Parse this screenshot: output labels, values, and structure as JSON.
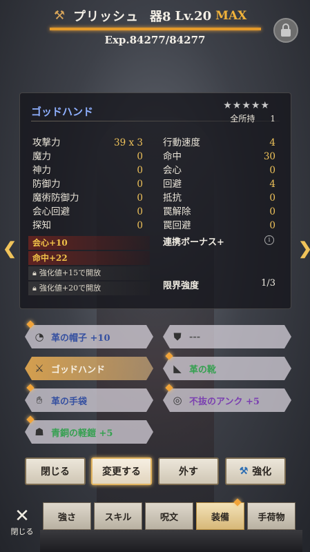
{
  "header": {
    "char_name": "プリッシュ",
    "vessel": "器8",
    "level": "Lv.20",
    "max": "MAX",
    "exp": "Exp.84277/84277"
  },
  "equipment": {
    "name": "ゴッドハンド",
    "stars": "★★★★★",
    "owned_label": "全所持",
    "owned_count": "1",
    "stats_left": [
      {
        "label": "攻撃力",
        "value": "39 x 3"
      },
      {
        "label": "魔力",
        "value": "0"
      },
      {
        "label": "神力",
        "value": "0"
      },
      {
        "label": "防御力",
        "value": "0"
      },
      {
        "label": "魔術防御力",
        "value": "0"
      },
      {
        "label": "会心回避",
        "value": "0"
      },
      {
        "label": "探知",
        "value": "0"
      }
    ],
    "stats_right": [
      {
        "label": "行動速度",
        "value": "4"
      },
      {
        "label": "命中",
        "value": "30"
      },
      {
        "label": "会心",
        "value": "0"
      },
      {
        "label": "回避",
        "value": "4"
      },
      {
        "label": "抵抗",
        "value": "0"
      },
      {
        "label": "罠解除",
        "value": "0"
      },
      {
        "label": "罠回避",
        "value": "0"
      }
    ],
    "bonuses": [
      "会心+10",
      "命中+22"
    ],
    "locked": [
      "強化値+15で開放",
      "強化値+20で開放"
    ],
    "link_bonus": "連携ボーナス+",
    "limit_label": "限界強度",
    "limit_value": "1/3"
  },
  "slots": [
    {
      "label": "革の帽子 +10",
      "icon": "hat-icon"
    },
    {
      "label": "---",
      "icon": "shield-icon"
    },
    {
      "label": "ゴッドハンド",
      "icon": "weapon-icon"
    },
    {
      "label": "革の靴",
      "icon": "boots-icon"
    },
    {
      "label": "革の手袋",
      "icon": "glove-icon"
    },
    {
      "label": "不抜のアンク +5",
      "icon": "ring-icon"
    },
    {
      "label": "青銅の軽鎧 +5",
      "icon": "armor-icon"
    }
  ],
  "actions": {
    "close": "閉じる",
    "change": "変更する",
    "remove": "外す",
    "enhance": "強化"
  },
  "nav": {
    "close": "閉じる",
    "tabs": [
      "強さ",
      "スキル",
      "呪文",
      "装備",
      "手荷物"
    ]
  },
  "colors": {
    "accent": "#f0b23a",
    "equipment_name": "#8fb0ff",
    "stat_value": "#f0c35a"
  }
}
